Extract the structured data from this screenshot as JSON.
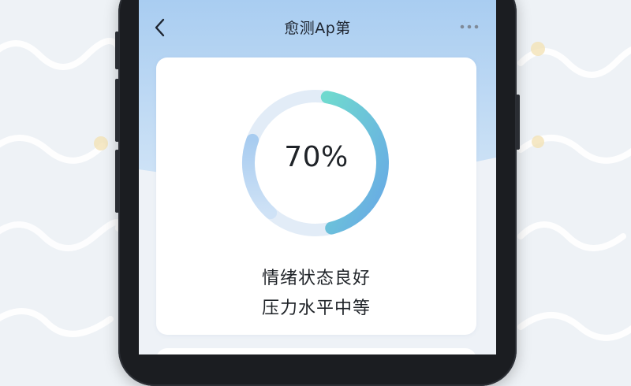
{
  "app": {
    "title": "愈测Ap第"
  },
  "gauge": {
    "percent_label": "70%",
    "value_fraction": 0.7
  },
  "status": {
    "line1": "情绪状态良好",
    "line2": "压力水平中等"
  },
  "icons": {
    "back": "chevron-left-icon",
    "more": "more-dots-icon"
  },
  "colors": {
    "header_top": "#a9cdf1",
    "gauge_start": "#6fd9cf",
    "gauge_end": "#68a8e6",
    "gauge_track": "#dde9f5"
  }
}
